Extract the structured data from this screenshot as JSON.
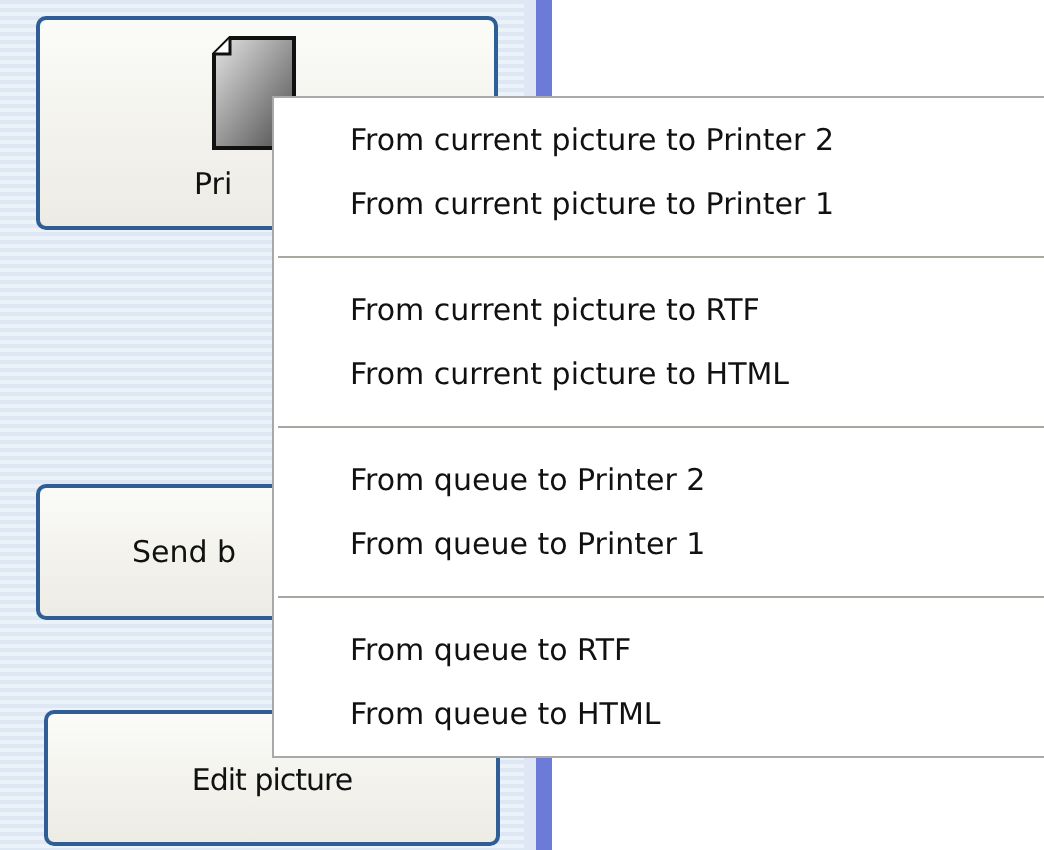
{
  "panel": {
    "buttons": [
      {
        "label": "Pri",
        "kind": "icon_button"
      },
      {
        "label": "Send b",
        "kind": "text_button"
      },
      {
        "label": "Edit picture",
        "kind": "text_button"
      }
    ]
  },
  "context_menu": {
    "groups": [
      [
        "From current picture to Printer 2",
        "From current picture to Printer 1"
      ],
      [
        "From current picture to RTF",
        "From current picture to HTML"
      ],
      [
        "From queue to Printer 2",
        "From queue to Printer 1"
      ],
      [
        "From queue to RTF",
        "From queue to HTML"
      ]
    ]
  }
}
